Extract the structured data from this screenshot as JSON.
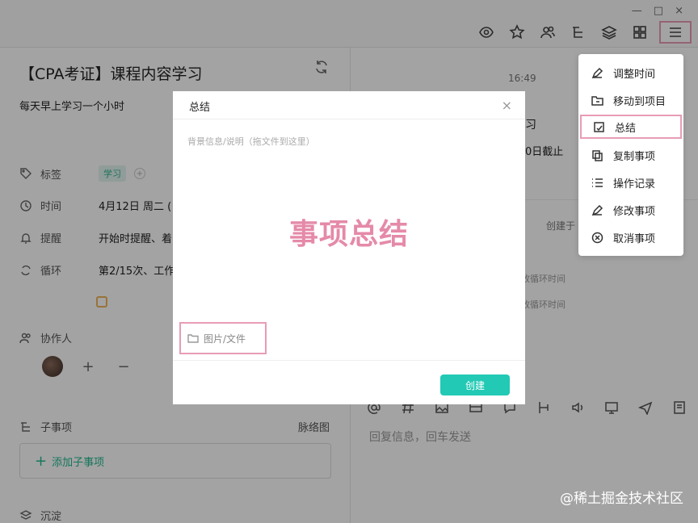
{
  "window": {
    "minimize": "—",
    "maximize": "□",
    "close": "×"
  },
  "toolbar": {
    "icons": [
      "eye-icon",
      "star-icon",
      "users-icon",
      "hierarchy-icon",
      "layers-icon",
      "apps-icon",
      "menu-icon"
    ]
  },
  "task": {
    "title": "【CPA考证】课程内容学习",
    "description": "每天早上学习一个小时",
    "tag_label": "标签",
    "tag_value": "学习",
    "time_label": "时间",
    "time_value": "4月12日 周二 (",
    "reminder_label": "提醒",
    "reminder_value": "开始时提醒、着",
    "repeat_label": "循环",
    "repeat_value": "第2/15次、工作",
    "collaborators_label": "协作人",
    "add_collab": "+",
    "remove_collab": "−",
    "subtasks_label": "子事项",
    "mindmap_label": "脉络图",
    "add_subtask": "添加子事项",
    "sink_label": "沉淀"
  },
  "activity": {
    "time": "16:49",
    "text1": "习",
    "text2": "0日截止",
    "created": "创建于",
    "log1": "更改循环时间",
    "log2": "更改循环时间",
    "reply_placeholder": "回复信息，回车发送"
  },
  "menu": {
    "items": [
      {
        "label": "调整时间",
        "icon": "pen-icon"
      },
      {
        "label": "移动到项目",
        "icon": "folder-icon"
      },
      {
        "label": "总结",
        "icon": "summary-icon"
      },
      {
        "label": "复制事项",
        "icon": "copy-icon"
      },
      {
        "label": "操作记录",
        "icon": "list-icon"
      },
      {
        "label": "修改事项",
        "icon": "edit-icon"
      },
      {
        "label": "取消事项",
        "icon": "cancel-icon"
      }
    ]
  },
  "dialog": {
    "title": "总结",
    "close": "×",
    "placeholder": "背景信息/说明（拖文件到这里）",
    "overlay_text": "事项总结",
    "attach_label": "图片/文件",
    "create_label": "创建"
  },
  "watermark": "@稀土掘金技术社区"
}
